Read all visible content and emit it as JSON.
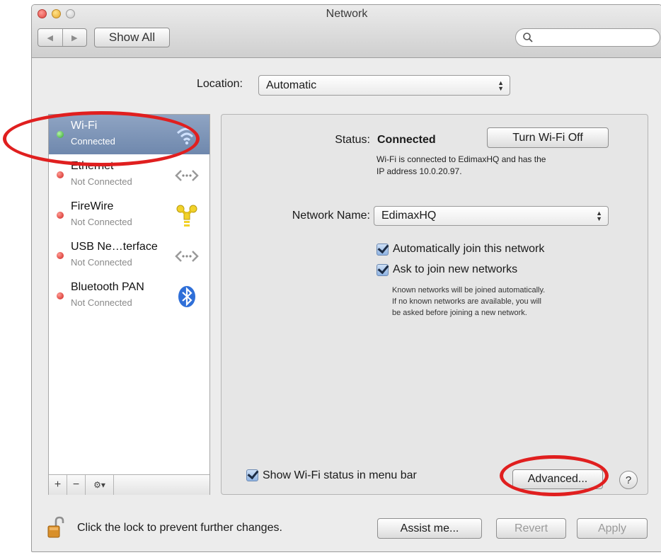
{
  "window": {
    "title": "Network"
  },
  "toolbar": {
    "show_all_label": "Show All",
    "back_glyph": "◀",
    "forward_glyph": "▶",
    "search_placeholder": ""
  },
  "location": {
    "label": "Location:",
    "value": "Automatic"
  },
  "services": [
    {
      "name": "Wi-Fi",
      "status": "Connected",
      "status_color": "green",
      "icon": "wifi-icon",
      "selected": true
    },
    {
      "name": "Ethernet",
      "status": "Not Connected",
      "status_color": "red",
      "icon": "ethernet-arrows-icon",
      "selected": false
    },
    {
      "name": "FireWire",
      "status": "Not Connected",
      "status_color": "red",
      "icon": "firewire-icon",
      "selected": false
    },
    {
      "name": "USB Ne…terface",
      "status": "Not Connected",
      "status_color": "red",
      "icon": "ethernet-arrows-icon",
      "selected": false
    },
    {
      "name": "Bluetooth PAN",
      "status": "Not Connected",
      "status_color": "red",
      "icon": "bluetooth-icon",
      "selected": false
    }
  ],
  "sidebar_toolbar": {
    "add": "+",
    "remove": "−",
    "gear": "⚙▾"
  },
  "detail": {
    "status_label": "Status:",
    "status_value": "Connected",
    "turn_off_button": "Turn Wi-Fi Off",
    "status_desc_1": "Wi-Fi is connected to EdimaxHQ and has the",
    "status_desc_2": "IP address 10.0.20.97.",
    "network_name_label": "Network Name:",
    "network_name_value": "EdimaxHQ",
    "auto_join_label": "Automatically join this network",
    "ask_join_label": "Ask to join new networks",
    "help_1": "Known networks will be joined automatically.",
    "help_2": "If no known networks are available, you will",
    "help_3": "be asked before joining a new network.",
    "show_status_label": "Show Wi-Fi status in menu bar",
    "advanced_button": "Advanced...",
    "help_button": "?"
  },
  "footer": {
    "lock_text": "Click the lock to prevent further changes.",
    "assist_button": "Assist me...",
    "revert_button": "Revert",
    "apply_button": "Apply"
  },
  "colors": {
    "highlight_ring": "#e01f1f",
    "selection": "#7b93b7",
    "status_green": "#2fa32c",
    "status_red": "#cf1f1b"
  }
}
